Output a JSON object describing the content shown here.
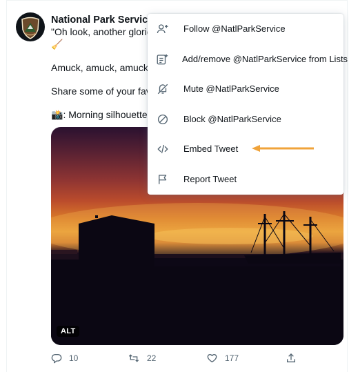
{
  "tweet": {
    "author_name": "National Park Service",
    "text_line1": "\"Oh look, another glorious",
    "text_line1_emoji": "🧹",
    "text_line2": "Amuck, amuck, amuck...",
    "text_line3": "Share some of your favor",
    "text_line4_emoji": "📸",
    "text_line4": ": Morning silhouette o",
    "alt_badge": "ALT",
    "stats": {
      "replies": "10",
      "retweets": "22",
      "likes": "177"
    }
  },
  "menu": {
    "items": [
      {
        "label": "Follow @NatlParkService",
        "icon": "follow-icon"
      },
      {
        "label": "Add/remove @NatlParkService from Lists",
        "icon": "list-add-icon"
      },
      {
        "label": "Mute @NatlParkService",
        "icon": "mute-icon"
      },
      {
        "label": "Block @NatlParkService",
        "icon": "block-icon"
      },
      {
        "label": "Embed Tweet",
        "icon": "embed-icon"
      },
      {
        "label": "Report Tweet",
        "icon": "flag-icon"
      }
    ]
  },
  "colors": {
    "verified": "#1d9bf0",
    "arrow": "#f0a33a",
    "muted": "#536471"
  }
}
